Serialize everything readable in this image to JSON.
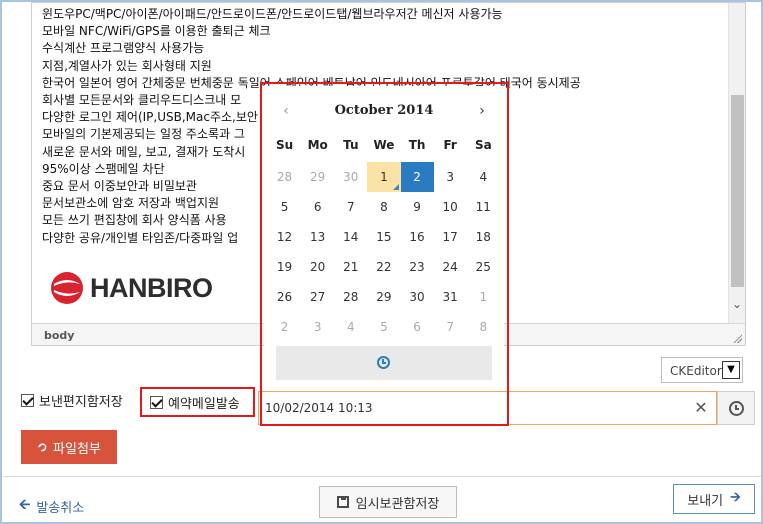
{
  "editor": {
    "lines": [
      "윈도우PC/맥PC/아이폰/아이패드/안드로이드폰/안드로이드탭/웹브라우저간 메신저 사용가능",
      "모바일 NFC/WiFi/GPS를 이용한 출퇴근 체크",
      "수식계산 프로그램양식 사용가능",
      "지점,계열사가 있는 회사형태 지원",
      "한국어 일본어 영어 간체중문 번체중문 독일어 스페인어 베트남어 인도네시아어 포르투갈어 태국어 동시제공",
      "회사별 모든문서와 클리우드디스크내 모",
      "다양한 로그인 제어(IP,USB,Mac주소,보안",
      "모바일의 기본제공되는 일정 주소록과 그",
      "새로운 문서와 메일, 보고, 결재가 도착시",
      "95%이상 스팸메일 차단",
      "중요 문서 이중보안과 비밀보관",
      "문서보관소에 암호 저장과 백업지원",
      "모든 쓰기 편집창에 회사 양식폼 사용",
      "다양한 공유/개인별 타임존/다중파일 업"
    ],
    "logo_text": "HANBIRO",
    "path_label": "body",
    "mode": "CKEditor"
  },
  "options": {
    "save_sent_label": "보낸편지함저장",
    "schedule_label": "예약메일발송"
  },
  "datetime": {
    "value": "10/02/2014 10:13"
  },
  "picker": {
    "month_title": "October 2014",
    "prev": "‹",
    "next": "›",
    "weekdays": [
      "Su",
      "Mo",
      "Tu",
      "We",
      "Th",
      "Fr",
      "Sa"
    ],
    "weeks": [
      [
        {
          "d": "28",
          "m": true
        },
        {
          "d": "29",
          "m": true
        },
        {
          "d": "30",
          "m": true
        },
        {
          "d": "1",
          "t": true
        },
        {
          "d": "2",
          "a": true
        },
        {
          "d": "3"
        },
        {
          "d": "4"
        }
      ],
      [
        {
          "d": "5"
        },
        {
          "d": "6"
        },
        {
          "d": "7"
        },
        {
          "d": "8"
        },
        {
          "d": "9"
        },
        {
          "d": "10"
        },
        {
          "d": "11"
        }
      ],
      [
        {
          "d": "12"
        },
        {
          "d": "13"
        },
        {
          "d": "14"
        },
        {
          "d": "15"
        },
        {
          "d": "16"
        },
        {
          "d": "17"
        },
        {
          "d": "18"
        }
      ],
      [
        {
          "d": "19"
        },
        {
          "d": "20"
        },
        {
          "d": "21"
        },
        {
          "d": "22"
        },
        {
          "d": "23"
        },
        {
          "d": "24"
        },
        {
          "d": "25"
        }
      ],
      [
        {
          "d": "26"
        },
        {
          "d": "27"
        },
        {
          "d": "28"
        },
        {
          "d": "29"
        },
        {
          "d": "30"
        },
        {
          "d": "31"
        },
        {
          "d": "1",
          "m": true
        }
      ],
      [
        {
          "d": "2",
          "m": true
        },
        {
          "d": "3",
          "m": true
        },
        {
          "d": "4",
          "m": true
        },
        {
          "d": "5",
          "m": true
        },
        {
          "d": "6",
          "m": true
        },
        {
          "d": "7",
          "m": true
        },
        {
          "d": "8",
          "m": true
        }
      ]
    ]
  },
  "actions": {
    "attach_label": "파일첨부",
    "cancel_label": "발송취소",
    "draft_label": "임시보관함저장",
    "send_label": "보내기"
  },
  "colors": {
    "accent": "#2a7bc0",
    "today": "#fbe3a5",
    "highlight_border": "#e21a1a",
    "attach_button": "#d7533b"
  }
}
